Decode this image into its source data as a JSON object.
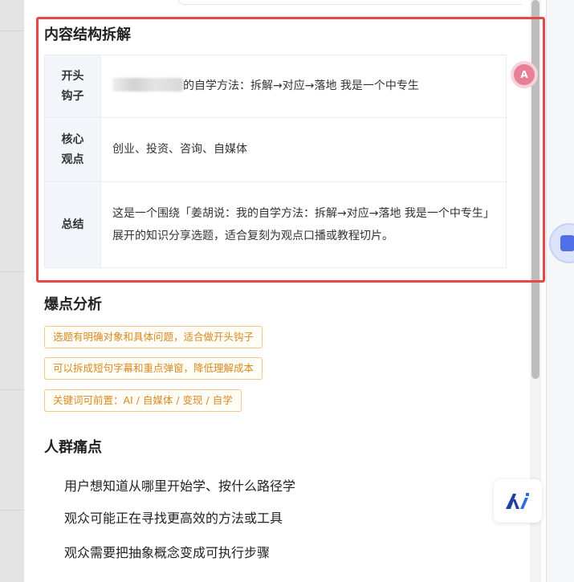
{
  "sections": {
    "structure_title": "内容结构拆解",
    "viral_title": "爆点分析",
    "pain_title": "人群痛点"
  },
  "structure_rows": [
    {
      "label": "开头\n钩子",
      "value": "的自学方法：拆解→对应→落地 我是一个中专生"
    },
    {
      "label": "核心\n观点",
      "value": "创业、投资、咨询、自媒体"
    },
    {
      "label": "总结",
      "value": "这是一个围绕「姜胡说：我的自学方法：拆解→对应→落地 我是一个中专生」展开的知识分享选题，适合复刻为观点口播或教程切片。"
    }
  ],
  "viral_tags": [
    "选题有明确对象和具体问题，适合做开头钩子",
    "可以拆成短句字幕和重点弹窗，降低理解成本",
    "关键词可前置：AI / 自媒体 / 变现 / 自学"
  ],
  "pain_points": [
    "用户想知道从哪里开始学、按什么路径学",
    "观众可能正在寻找更高效的方法或工具",
    "观众需要把抽象概念变成可执行步骤"
  ],
  "icons": {
    "translate": "translate-icon",
    "side_widget": "assistant-bubble-icon",
    "ai_logo": "ai-logo-icon"
  },
  "colors": {
    "highlight_border": "#e2474a",
    "tag_text": "#d88a22",
    "tag_border": "#f0c98a"
  }
}
